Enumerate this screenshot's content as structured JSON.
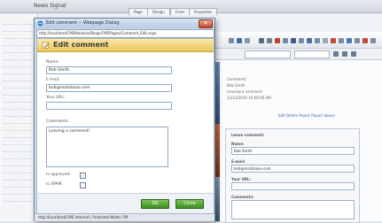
{
  "background_window": {
    "title": "News Signal",
    "tabs": [
      "Page",
      "Design",
      "Form",
      "Properties"
    ],
    "comment_preview": [
      "Comments",
      "Bob Smith",
      "Leaving a comment",
      "12/12/2010 10:00:00 AM"
    ],
    "comment_actions": "Edit Delete Reject Report abuse",
    "form_panel": {
      "title": "Leave comment:",
      "name_label": "Name:",
      "name_value": "Bob Smith",
      "email_label": "E-mail:",
      "email_value": "bob@mailsbase.com",
      "url_label": "Your URL:",
      "comments_label": "Comments:"
    }
  },
  "dialog": {
    "window_title": "Edit comment -- Webpage Dialog",
    "url": "http://localhost/CMSModules/Blogs/CMSPages/Comment_Edit.aspx",
    "heading": "Edit comment",
    "fields": {
      "name_label": "Name:",
      "name_value": "Bob Smith",
      "email_label": "E-mail:",
      "email_value": "bob@mailsbase.com",
      "url_label": "Your URL:",
      "url_value": "",
      "comments_label": "Comments:",
      "comments_value": "Leaving a comment!"
    },
    "checkboxes": [
      {
        "label": "Is approved:",
        "checked": true
      },
      {
        "label": "Is SPAM:",
        "checked": false
      }
    ],
    "buttons": {
      "ok": "OK",
      "close": "Close"
    },
    "close_glyph": "✕",
    "status_text": "http://localhost/CMS  Internet | Protected Mode: Off"
  },
  "colors": {
    "header_gradient_top": "#fbe9a9",
    "button_green": "#3e8f23",
    "titlebar": "#b6cbe1"
  }
}
